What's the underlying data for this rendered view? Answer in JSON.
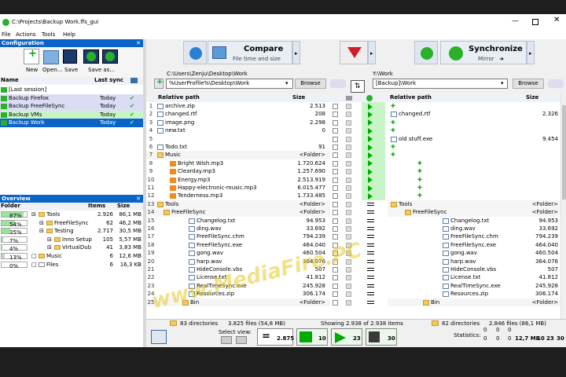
{
  "window": {
    "title": "C:\\Projects\\Backup Work.ffs_gui"
  },
  "menu": [
    "File",
    "Actions",
    "Tools",
    "Help"
  ],
  "config": {
    "header": "Configuration",
    "tools": [
      "New",
      "Open...",
      "Save",
      "Save as..."
    ],
    "col_name": "Name",
    "col_last": "Last sync",
    "items": [
      {
        "name": "[Last session]",
        "last": ""
      },
      {
        "name": "Backup Firefox",
        "last": "Today"
      },
      {
        "name": "Backup FreeFileSync",
        "last": "Today"
      },
      {
        "name": "Backup VMs",
        "last": "Today"
      },
      {
        "name": "Backup Work",
        "last": "Today"
      }
    ]
  },
  "overview": {
    "header": "Overview",
    "col_folder": "Folder",
    "col_items": "Items",
    "col_size": "Size",
    "rows": [
      {
        "pct": "87%",
        "name": "Tools",
        "items": "2.926",
        "size": "86,1 MB"
      },
      {
        "pct": "54%",
        "name": "FreeFileSync",
        "items": "62",
        "size": "46,2 MB"
      },
      {
        "pct": "35%",
        "name": "Testing",
        "items": "2.717",
        "size": "30,5 MB"
      },
      {
        "pct": "7%",
        "name": "Inno Setup",
        "items": "105",
        "size": "5,57 MB"
      },
      {
        "pct": "4%",
        "name": "VirtualDub",
        "items": "41",
        "size": "3,83 MB"
      },
      {
        "pct": "13%",
        "name": "Music",
        "items": "6",
        "size": "12,6 MB"
      },
      {
        "pct": "0%",
        "name": "Files",
        "items": "6",
        "size": "16,3 KB"
      }
    ]
  },
  "compare": {
    "label": "Compare",
    "sub": "File time and size"
  },
  "sync": {
    "label": "Synchronize",
    "sub": "Mirror"
  },
  "left": {
    "path_label": "C:\\Users\\Zenju\\Desktop\\Work",
    "path": "%UserProfile%\\Desktop\\Work",
    "browse": "Browse",
    "col_path": "Relative path",
    "col_size": "Size",
    "status_dirs": "83 directories",
    "status_files": "3.825 files (54,8 MB)"
  },
  "right": {
    "path_label": "Y:\\Work",
    "path": "[Backup]\\Work",
    "browse": "Browse",
    "col_path": "Relative path",
    "col_size": "Size",
    "status_dirs": "82 directories",
    "status_files": "2.846 files (86,1 MB)"
  },
  "middle": {
    "status": "Showing 2.938 of 2.938 items"
  },
  "left_rows": [
    {
      "n": "1",
      "name": "archive.zip",
      "size": "2.513"
    },
    {
      "n": "2",
      "name": "changed.rtf",
      "size": "208"
    },
    {
      "n": "3",
      "name": "image.png",
      "size": "2.298"
    },
    {
      "n": "4",
      "name": "new.txt",
      "size": "0"
    },
    {
      "n": "5",
      "name": "",
      "size": ""
    },
    {
      "n": "6",
      "name": "Todo.txt",
      "size": "91"
    },
    {
      "n": "7",
      "name": "Music",
      "size": "<Folder>"
    },
    {
      "n": "8",
      "name": "Bright Wish.mp3",
      "size": "1.720.624"
    },
    {
      "n": "9",
      "name": "Clearday.mp3",
      "size": "1.257.690"
    },
    {
      "n": "10",
      "name": "Energy.mp3",
      "size": "2.513.919"
    },
    {
      "n": "11",
      "name": "Happy-electronic-music.mp3",
      "size": "6.015.477"
    },
    {
      "n": "12",
      "name": "Tenderness.mp3",
      "size": "1.733.485"
    },
    {
      "n": "13",
      "name": "Tools",
      "size": "<Folder>"
    },
    {
      "n": "14",
      "name": "FreeFileSync",
      "size": "<Folder>"
    },
    {
      "n": "15",
      "name": "Changelog.txt",
      "size": "94.953"
    },
    {
      "n": "16",
      "name": "ding.wav",
      "size": "33.692"
    },
    {
      "n": "17",
      "name": "FreeFileSync.chm",
      "size": "794.239"
    },
    {
      "n": "18",
      "name": "FreeFileSync.exe",
      "size": "464.040"
    },
    {
      "n": "19",
      "name": "gong.wav",
      "size": "460.504"
    },
    {
      "n": "20",
      "name": "harp.wav",
      "size": "364.076"
    },
    {
      "n": "21",
      "name": "HideConsole.vbs",
      "size": "507"
    },
    {
      "n": "22",
      "name": "License.txt",
      "size": "41.812"
    },
    {
      "n": "23",
      "name": "RealTimeSync.exe",
      "size": "245.928"
    },
    {
      "n": "24",
      "name": "Resources.zip",
      "size": "306.174"
    },
    {
      "n": "25",
      "name": "Bin",
      "size": "<Folder>"
    }
  ],
  "right_rows": [
    {
      "name": "",
      "size": ""
    },
    {
      "name": "changed.rtf",
      "size": "2.326"
    },
    {
      "name": "",
      "size": ""
    },
    {
      "name": "",
      "size": ""
    },
    {
      "name": "old stuff.exe",
      "size": "9.454"
    },
    {
      "name": "",
      "size": ""
    },
    {
      "name": "",
      "size": ""
    },
    {
      "name": "",
      "size": ""
    },
    {
      "name": "",
      "size": ""
    },
    {
      "name": "",
      "size": ""
    },
    {
      "name": "",
      "size": ""
    },
    {
      "name": "",
      "size": ""
    },
    {
      "name": "Tools",
      "size": "<Folder>"
    },
    {
      "name": "FreeFileSync",
      "size": "<Folder>"
    },
    {
      "name": "Changelog.txt",
      "size": "94.953"
    },
    {
      "name": "ding.wav",
      "size": "33.692"
    },
    {
      "name": "FreeFileSync.chm",
      "size": "794.239"
    },
    {
      "name": "FreeFileSync.exe",
      "size": "464.040"
    },
    {
      "name": "gong.wav",
      "size": "460.504"
    },
    {
      "name": "harp.wav",
      "size": "364.076"
    },
    {
      "name": "HideConsole.vbs",
      "size": "507"
    },
    {
      "name": "License.txt",
      "size": "41.812"
    },
    {
      "name": "RealTimeSync.exe",
      "size": "245.928"
    },
    {
      "name": "Resources.zip",
      "size": "306.174"
    },
    {
      "name": "Bin",
      "size": "<Folder>"
    }
  ],
  "bottom": {
    "select_view": "Select view:",
    "counts": [
      "2.875",
      "10",
      "23",
      "30"
    ],
    "statistics": "Statistics:",
    "stats_top": [
      "0",
      "0",
      "0"
    ],
    "stats_bottom": [
      "0",
      "0",
      "0",
      "12,7 MB",
      "10",
      "23",
      "30"
    ]
  },
  "watermark": "www.MediaFire.PC"
}
